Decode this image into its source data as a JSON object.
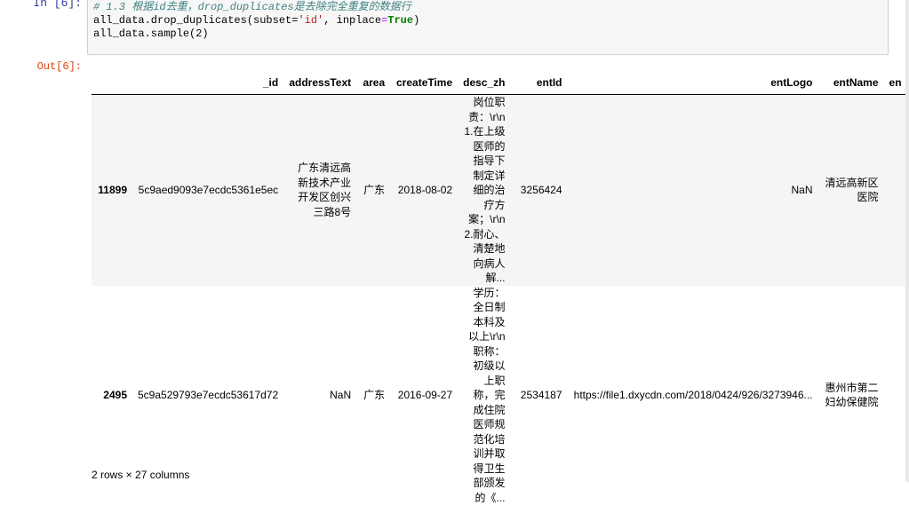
{
  "input_cell": {
    "prompt": "In [6]:",
    "comment": "# 1.3 根据id去重，drop_duplicates是去除完全重复的数据行",
    "line2_prefix": "all_data.drop_duplicates(subset=",
    "line2_str": "'id'",
    "line2_mid": ", inplace",
    "line2_eq": "=",
    "line2_kw": "True",
    "line2_end": ")",
    "line3": "all_data.sample(2)"
  },
  "output_cell": {
    "prompt": "Out[6]:",
    "columns": [
      "",
      "_id",
      "addressText",
      "area",
      "createTime",
      "desc_zh",
      "entId",
      "entLogo",
      "entName",
      "en"
    ],
    "rows": [
      {
        "index": "11899",
        "_id": "5c9aed9093e7ecdc5361e5ec",
        "addressText": "广东清远高新技术产业开发区创兴三路8号",
        "area": "广东",
        "createTime": "2018-08-02",
        "desc_zh": "岗位职责：\\r\\n1.在上级医师的指导下制定详细的治疗方案；\\r\\n2.耐心、清楚地向病人解...",
        "entId": "3256424",
        "entLogo": "NaN",
        "entName": "清远高新区医院"
      },
      {
        "index": "2495",
        "_id": "5c9a529793e7ecdc53617d72",
        "addressText": "NaN",
        "area": "广东",
        "createTime": "2016-09-27",
        "desc_zh": "学历：全日制本科及以上\\r\\n职称：初级以上职称，完成住院医师规范化培训并取得卫生部颁发的《...",
        "entId": "2534187",
        "entLogo": "https://file1.dxycdn.com/2018/0424/926/3273946...",
        "entName": "惠州市第二妇幼保健院"
      }
    ],
    "footer": "2 rows × 27 columns"
  }
}
